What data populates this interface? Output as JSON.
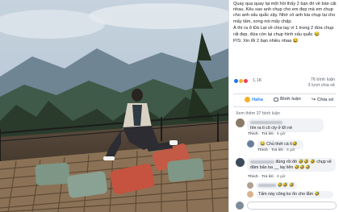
{
  "post": {
    "paragraphs": [
      "Quay qua quay lại một hồi thấy 2 bạn đó về bàn cãi nhau. Kêu sao anh chụp cho em đẹp mà em chụp cho anh xấu quắc zậy. Nhờ cô anh kia chụp lại cho mấy tấm, xong nói mấy chập.",
      "À thì ra ở Đà Lạt về chia tay vì 1 trong 2 đứa chụp rất đẹp, đứa còn lại chụp hình xấu quắc 😂",
      "P/S: Xin lỗi 2 bạn nhiều nhaa 😂"
    ]
  },
  "reactions": {
    "count": "1,1K",
    "comments": "76 bình luận",
    "shares": "3 lượt chia sẻ",
    "colors": {
      "like": "#1877f2",
      "haha": "#f7b125",
      "love": "#f33e58"
    }
  },
  "actions": {
    "haha": "Haha",
    "comment": "Bình luận",
    "share": "Chia sẻ",
    "haha_icon": "haha-emoji-icon",
    "comment_icon": "comment-icon",
    "share_icon": "share-icon"
  },
  "comments_section": {
    "more_label": "Xem thêm 37 bình luận",
    "items": [
      {
        "text": "tìm ra ti cô cty ở Đì nè",
        "meta_like": "Thích",
        "meta_reply": "Trả lời",
        "meta_time": "8 giờ"
      },
      {
        "text": "😂 Chủ thớt cà tí🤣",
        "meta_like": "Thích",
        "meta_reply": "Trả lời",
        "meta_time": "8 giờ"
      },
      {
        "text": "đúng rồi đó 🤣🤣 🤣 chụp về đâm bảo ba __ lay liên 🤣🤣🤣",
        "meta_like": "Thích",
        "meta_reply": "Trả lời",
        "meta_time": "8 giờ"
      },
      {
        "text": "Tấm này cũng ko ổn cho lắm 🤣",
        "meta_like": "Thích",
        "meta_reply": "Trả lời",
        "meta_time": "8 giờ"
      }
    ],
    "blur_reply": "🤣🤣 🤣"
  }
}
